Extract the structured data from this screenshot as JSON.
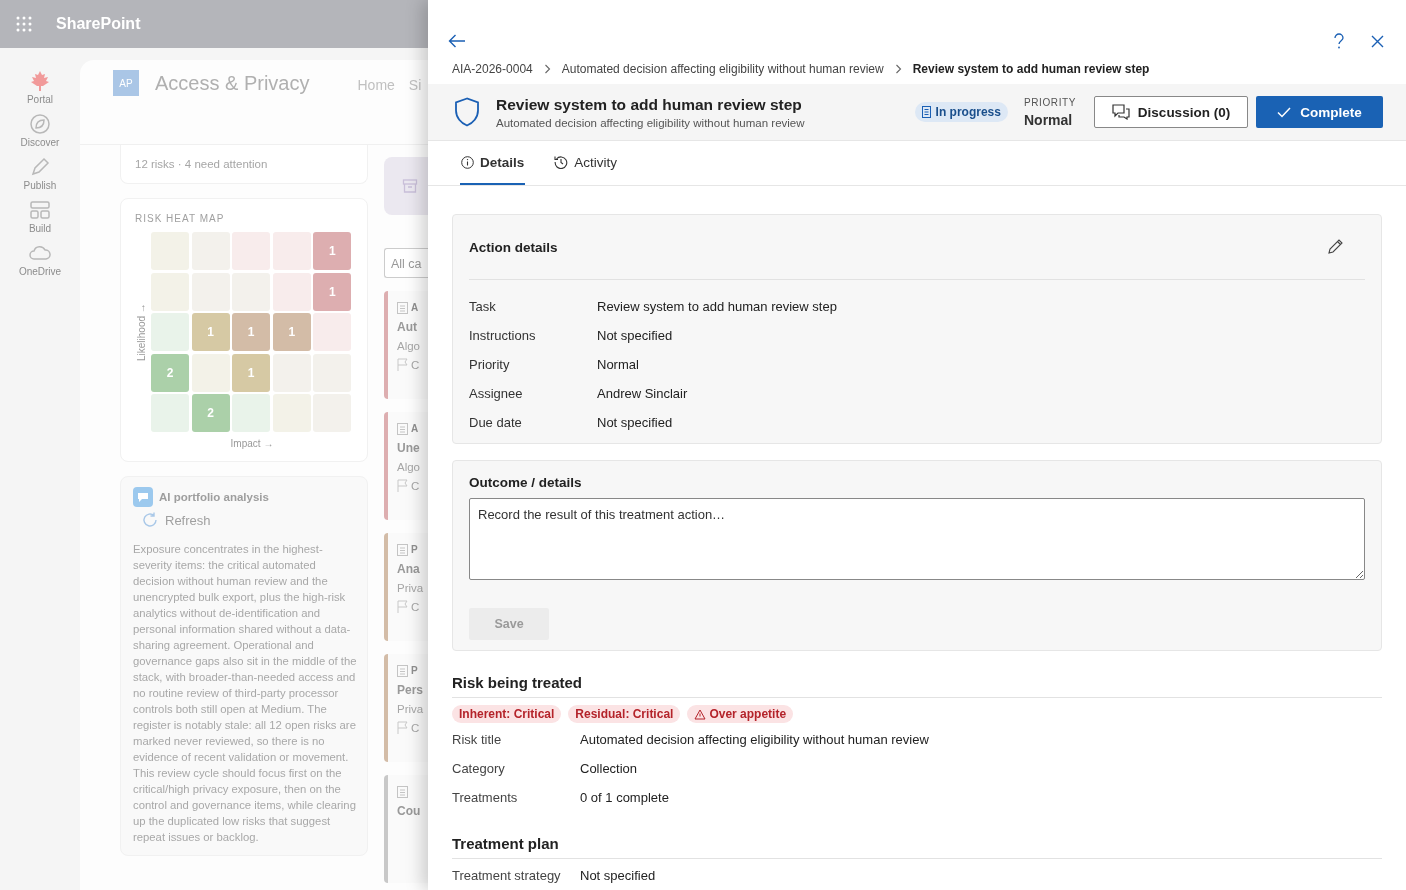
{
  "app_bar": {
    "title": "SharePoint"
  },
  "nav": [
    {
      "label": "Portal"
    },
    {
      "label": "Discover"
    },
    {
      "label": "Publish"
    },
    {
      "label": "Build"
    },
    {
      "label": "OneDrive"
    }
  ],
  "site": {
    "logo": "AP",
    "title": "Access & Privacy",
    "links": [
      "Home",
      "Si"
    ]
  },
  "summary": "12 risks · 4 need attention",
  "heat_map": {
    "title": "RISK HEAT MAP",
    "y_label": "Likelihood →",
    "x_label": "Impact →",
    "rows": [
      [
        {
          "color": "#f3f2e8"
        },
        {
          "color": "#f3f1ec"
        },
        {
          "color": "#f8ecec"
        },
        {
          "color": "#f8ecec"
        },
        {
          "color": "#ddaeb0",
          "count": "1"
        }
      ],
      [
        {
          "color": "#f3f2e8"
        },
        {
          "color": "#f3f1ec"
        },
        {
          "color": "#f3f1ec"
        },
        {
          "color": "#f8ecec"
        },
        {
          "color": "#ddaeb0",
          "count": "1"
        }
      ],
      [
        {
          "color": "#e9f3ea"
        },
        {
          "color": "#d6c9a4",
          "count": "1"
        },
        {
          "color": "#d3bca7",
          "count": "1"
        },
        {
          "color": "#d3bca7",
          "count": "1"
        },
        {
          "color": "#f8ecec"
        }
      ],
      [
        {
          "color": "#abd0a9",
          "count": "2"
        },
        {
          "color": "#f3f2e8"
        },
        {
          "color": "#d6c9a4",
          "count": "1"
        },
        {
          "color": "#f3f1ec"
        },
        {
          "color": "#f3f1ec"
        }
      ],
      [
        {
          "color": "#e9f3ea"
        },
        {
          "color": "#abd0a9",
          "count": "2"
        },
        {
          "color": "#e9f3ea"
        },
        {
          "color": "#f3f2e8"
        },
        {
          "color": "#f3f1ec"
        }
      ]
    ]
  },
  "ai": {
    "title": "AI portfolio analysis",
    "refresh": "Refresh",
    "text": "Exposure concentrates in the highest-severity items: the critical automated decision without human review and the unencrypted bulk export, plus the high-risk analytics without de-identification and personal information shared without a data-sharing agreement. Operational and governance gaps also sit in the middle of the stack, with broader-than-needed access and no routine review of third-party processor controls both still open at Medium. The register is notably stale: all 12 open risks are marked never reviewed, so there is no evidence of recent validation or movement. This review cycle should focus first on the critical/high privacy exposure, then on the control and governance items, while clearing up the duplicated low risks that suggest repeat issues or backlog."
  },
  "risk_list": {
    "filter": "All ca",
    "cards": [
      {
        "tag": "A",
        "title": "Aut",
        "subtitle": "Algo",
        "owner": "C",
        "color": "#ddaeb0"
      },
      {
        "tag": "A",
        "title": "Une",
        "subtitle": "Algo",
        "owner": "C",
        "color": "#ddaeb0"
      },
      {
        "tag": "P",
        "title": "Ana",
        "subtitle": "Priva",
        "owner": "C",
        "color": "#d3bca7"
      },
      {
        "tag": "P",
        "title": "Pers",
        "subtitle": "Priva",
        "owner": "C",
        "color": "#d3bca7"
      },
      {
        "title": "Cou",
        "color": "#c8c8c8"
      }
    ]
  },
  "panel": {
    "breadcrumb": [
      "AIA-2026-0004",
      "Automated decision affecting eligibility without human review",
      "Review system to add human review step"
    ],
    "header": {
      "title": "Review system to add human review step",
      "subtitle": "Automated decision affecting eligibility without human review",
      "status": "In progress",
      "priority_label": "PRIORITY",
      "priority": "Normal",
      "discussion": "Discussion (0)",
      "complete": "Complete"
    },
    "tabs": [
      {
        "label": "Details",
        "selected": true
      },
      {
        "label": "Activity",
        "selected": false
      }
    ],
    "action_details": {
      "title": "Action details",
      "fields": [
        {
          "label": "Task",
          "value": "Review system to add human review step"
        },
        {
          "label": "Instructions",
          "value": "Not specified"
        },
        {
          "label": "Priority",
          "value": "Normal"
        },
        {
          "label": "Assignee",
          "value": "Andrew Sinclair"
        },
        {
          "label": "Due date",
          "value": "Not specified"
        }
      ]
    },
    "outcome": {
      "title": "Outcome / details",
      "placeholder": "Record the result of this treatment action…",
      "save": {
        "label": "Save",
        "disabled": true
      }
    },
    "risk": {
      "title": "Risk being treated",
      "chips": [
        {
          "label": "Inherent: Critical",
          "kind": "level"
        },
        {
          "label": "Residual: Critical",
          "kind": "level"
        },
        {
          "label": "Over appetite",
          "kind": "warning"
        }
      ],
      "fields": [
        {
          "label": "Risk title",
          "value": "Automated decision affecting eligibility without human review"
        },
        {
          "label": "Category",
          "value": "Collection"
        },
        {
          "label": "Treatments",
          "value": "0 of 1 complete"
        }
      ]
    },
    "plan": {
      "title": "Treatment plan",
      "fields": [
        {
          "label": "Treatment strategy",
          "value": "Not specified"
        }
      ]
    }
  }
}
